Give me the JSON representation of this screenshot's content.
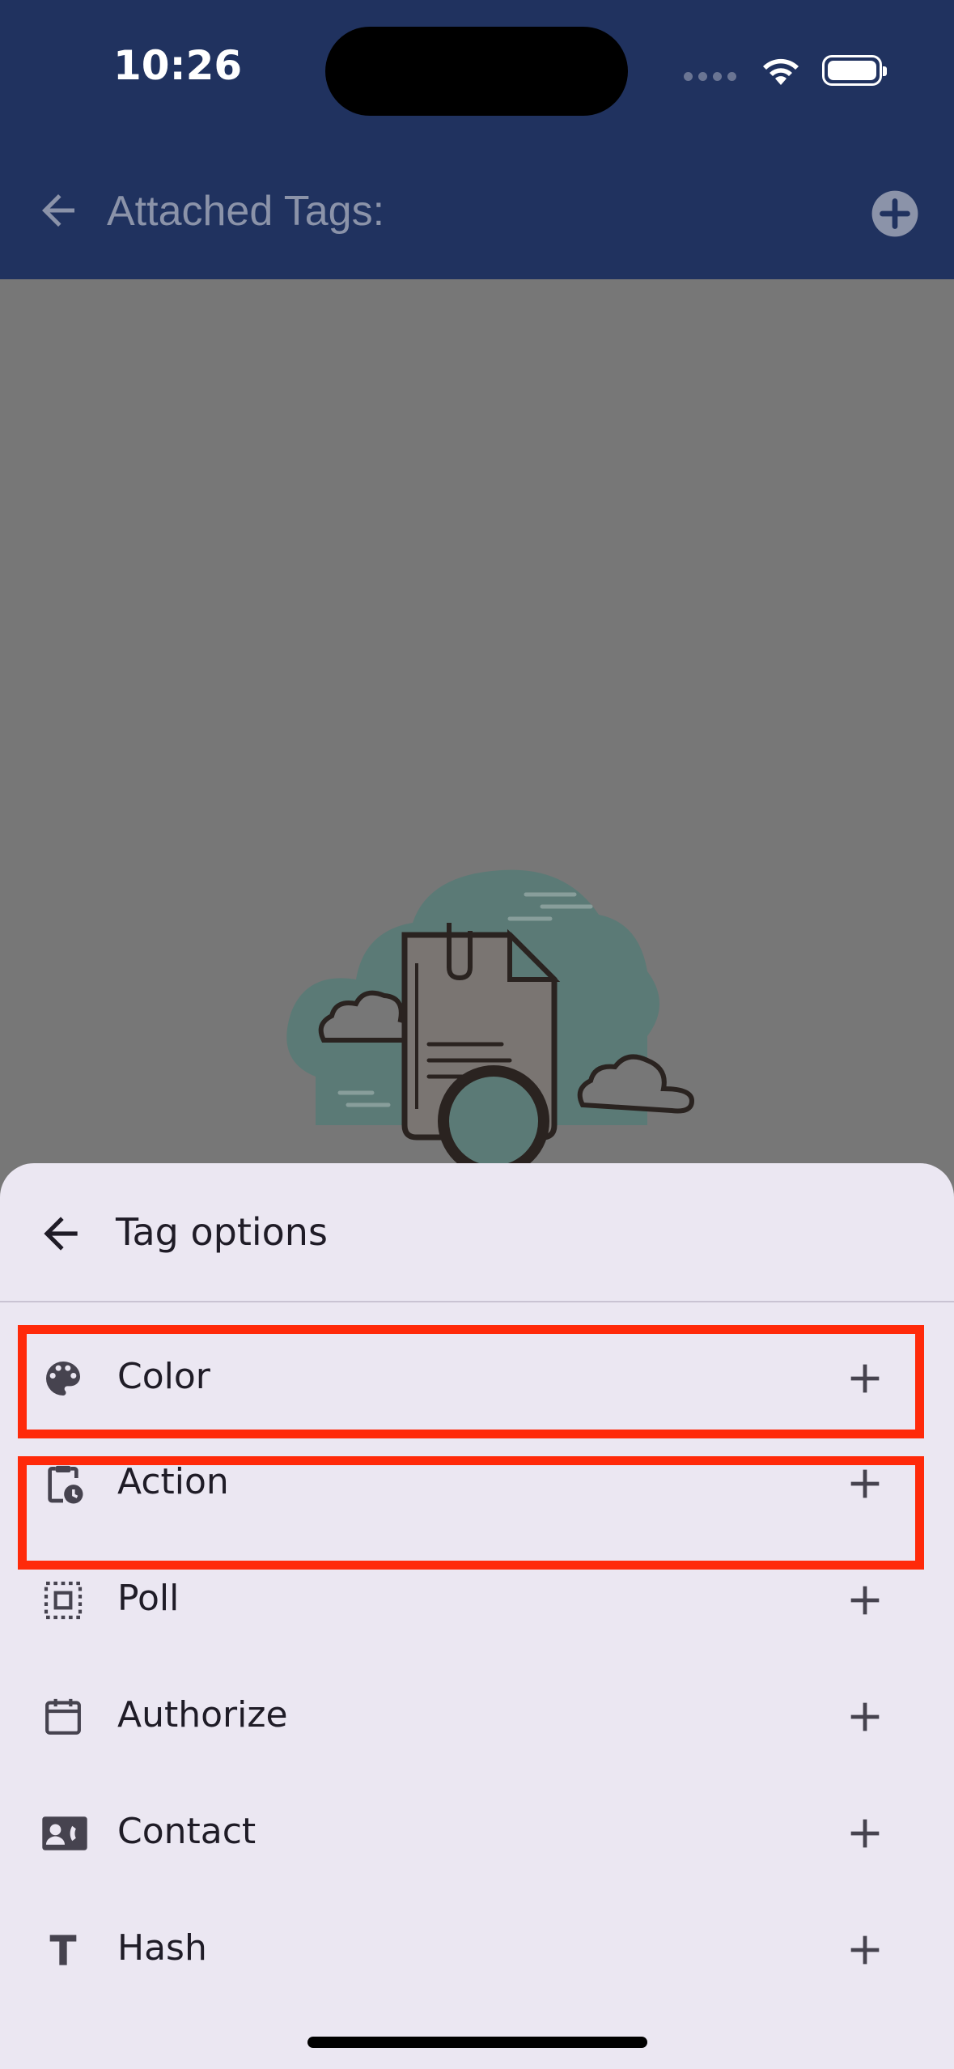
{
  "status_bar": {
    "time": "10:26"
  },
  "app_bar": {
    "title": "Attached Tags:",
    "back_icon": "arrow-left-icon",
    "add_icon": "add-circle-icon"
  },
  "sheet": {
    "title": "Tag options",
    "back_icon": "arrow-left-icon",
    "options": [
      {
        "label": "Color",
        "icon": "palette-icon"
      },
      {
        "label": "Action",
        "icon": "clipboard-clock-icon"
      },
      {
        "label": "Poll",
        "icon": "select-all-icon"
      },
      {
        "label": "Authorize",
        "icon": "calendar-icon"
      },
      {
        "label": "Contact",
        "icon": "contact-card-icon"
      },
      {
        "label": "Hash",
        "icon": "text-t-icon"
      }
    ]
  },
  "colors": {
    "app_bar": "#20325f",
    "sheet_bg": "#ebe7f2",
    "highlight": "#ff2a0a",
    "scrim_bg": "#787878"
  }
}
